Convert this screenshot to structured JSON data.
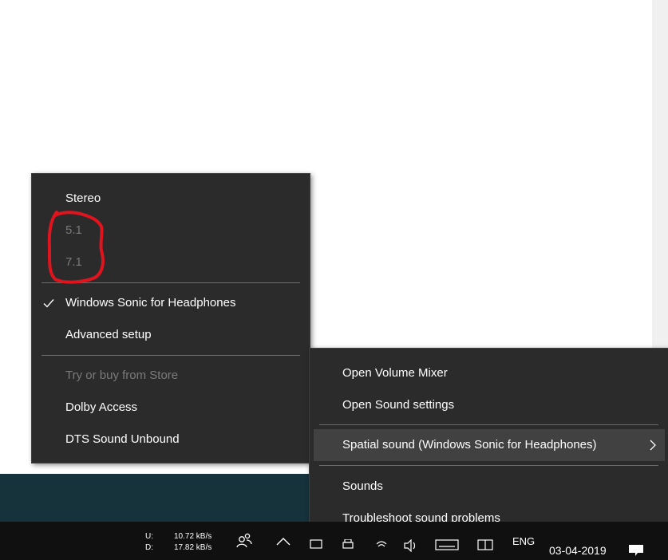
{
  "spatial_menu": {
    "items": [
      {
        "label": "Stereo"
      },
      {
        "label": "5.1",
        "disabled": true
      },
      {
        "label": "7.1",
        "disabled": true
      },
      {
        "label": "Windows Sonic for Headphones",
        "checked": true
      },
      {
        "label": "Advanced setup"
      },
      {
        "label": "Try or buy from Store",
        "disabled": true
      },
      {
        "label": "Dolby Access"
      },
      {
        "label": "DTS Sound Unbound"
      }
    ]
  },
  "sound_menu": {
    "items": [
      {
        "label": "Open Volume Mixer"
      },
      {
        "label": "Open Sound settings"
      },
      {
        "label": "Spatial sound (Windows Sonic for Headphones)",
        "has_submenu": true,
        "highlighted": true
      },
      {
        "label": "Sounds"
      },
      {
        "label": "Troubleshoot sound problems"
      }
    ]
  },
  "taskbar": {
    "net_upload_label": "U:",
    "net_download_label": "D:",
    "net_upload_value": "10.72 kB/s",
    "net_download_value": "17.82 kB/s",
    "language": "ENG",
    "date": "03-04-2019"
  },
  "colors": {
    "menu_bg": "#2b2b2b",
    "menu_highlight": "#414141",
    "annotation": "#e0141e",
    "taskbar_bg": "#101010",
    "teal_band": "#16323a"
  }
}
